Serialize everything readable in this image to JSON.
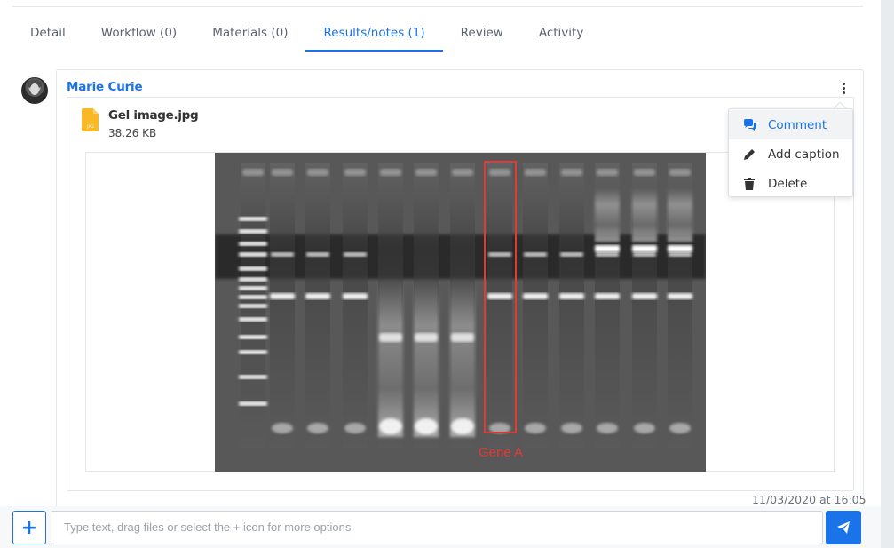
{
  "tabs": [
    {
      "label": "Detail"
    },
    {
      "label": "Workflow (0)"
    },
    {
      "label": "Materials (0)"
    },
    {
      "label": "Results/notes (1)"
    },
    {
      "label": "Review"
    },
    {
      "label": "Activity"
    }
  ],
  "active_tab": "Results/notes (1)",
  "note": {
    "author": "Marie Curie",
    "file": {
      "name": "Gel image.jpg",
      "size": "38.26 KB",
      "icon": "jpg-file-icon"
    },
    "image_label": "Gene A",
    "timestamp": "11/03/2020 at 16:05"
  },
  "context_menu": {
    "items": [
      {
        "label": "Comment",
        "icon": "comments-icon",
        "highlighted": true
      },
      {
        "label": "Add caption",
        "icon": "pencil-icon",
        "highlighted": false
      },
      {
        "label": "Delete",
        "icon": "trash-icon",
        "highlighted": false
      }
    ]
  },
  "composer": {
    "add_label": "+",
    "placeholder": "Type text, drag files or select the + icon for more options",
    "send_icon": "paper-plane-icon"
  },
  "colors": {
    "accent": "#1a73e8",
    "gel_highlight": "#e53935"
  }
}
